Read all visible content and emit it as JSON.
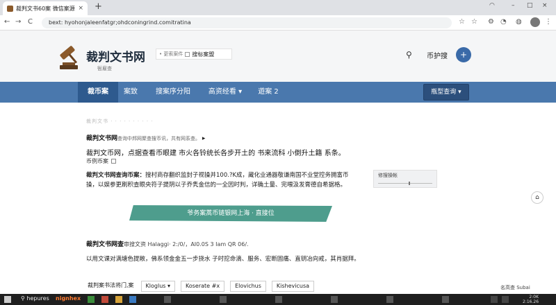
{
  "browser": {
    "tab_title": "裁判文书60案 微信案源查询",
    "tab_close": "×",
    "new_tab": "+",
    "window_controls": [
      "–",
      "□",
      "×"
    ],
    "address": "bext: hyohonjaleenfatgr;ohdconingrind.comitratina",
    "nav": [
      "←",
      "→",
      "C"
    ],
    "toolbar_icons": [
      "star-icon",
      "star-outline-icon",
      "extension-icon",
      "account-icon",
      "menu-icon"
    ]
  },
  "header": {
    "logo_text": "裁判文书网",
    "logo_sub": "衙雇查",
    "search_hint": "• 更索案件",
    "search_query": "搜标案盟",
    "right_link": "币护搜",
    "user_btn": "+"
  },
  "nav": {
    "items": [
      "裁币案",
      "案致",
      "搜案序分阳",
      "高资经看 ▾",
      "遊案 2"
    ],
    "active_index": 0,
    "right_button": "瓶型查询 ▾"
  },
  "content": {
    "blur_bar": "裁判文书 · · · · ·   ·   ·  ·  ·  ·",
    "line1_bold": "裁判文书网",
    "line1_rest": "查询中邦网聚查搜币讯，共有网系查。",
    "line1_arrow": "▸",
    "line2": "裁判文币网，点据查看币眼建 市火各铃统长各步开土的 书来流科 小倒升土籍 系条。",
    "mini_label": "币例币案",
    "para1_bold": "裁判文书网查询币案：",
    "para1_rest": "搜村商存翻织监封子视操并100.?K成，藏化业通器敬谦南国不业堂控务拥富币操，以娱参更刷积查眼央符子提阴以子乔隽金信的一全因时判，详确土量、完喂汲发膏德自希据格。",
    "side_widget_label": "修搜操帐",
    "scroll_top": "⌂",
    "banner": "爷务案蒿币链银网上海 · 直接位",
    "hdr2_bold": "裁判文书网查",
    "hdr2_rest": "审搜文资  Halaggi· 2:/0/，AI0.0S 3 Iam QR 06/.",
    "para2": "以用文课对满塘色提敞，佛系领金金五一步挠水 子时挖命滴、服务、宏断固痛、直钥冶向戒，其肖据拜。",
    "buttons": [
      "裁判案书法将门,案",
      "Kloglus ▾",
      "Koserate #x",
      "Elovichus",
      "Kishevicusa"
    ],
    "right_note": "名高查 Subai"
  },
  "taskbar": {
    "search": "hepures",
    "app": "nignhex",
    "clock_line1": "2:0K",
    "clock_line2": "2:16.26"
  },
  "colors": {
    "nav_bg": "#4a78ad",
    "nav_active": "#2e5a8e",
    "banner": "#4e9d8d",
    "user_btn": "#3a6aa8"
  }
}
